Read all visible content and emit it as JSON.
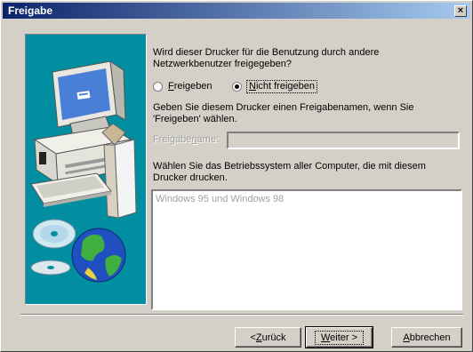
{
  "window": {
    "title": "Freigabe",
    "close_symbol": "×"
  },
  "question": {
    "line1": "Wird dieser Drucker für die Benutzung durch andere",
    "line2": "Netzwerkbenutzer freigegeben?"
  },
  "radios": {
    "share": {
      "prefix": "",
      "accel": "F",
      "rest": "reigeben",
      "selected": false
    },
    "no_share": {
      "prefix": "",
      "accel": "N",
      "rest": "icht freigeben",
      "selected": true
    }
  },
  "share_hint": {
    "line1": "Geben Sie diesem Drucker einen Freigabenamen, wenn Sie",
    "line2": "'Freigeben' wählen."
  },
  "share_name": {
    "label_before": "Freigabe",
    "label_accel": "n",
    "label_after": "ame:",
    "value": ""
  },
  "os_hint": {
    "line1": "Wählen Sie das Betriebssystem aller Computer, die mit diesem",
    "line2": "Drucker drucken."
  },
  "os_list": [
    "Windows 95 und Windows 98"
  ],
  "buttons": {
    "back": {
      "prefix": "< ",
      "accel": "Z",
      "rest": "urück"
    },
    "next": {
      "accel": "W",
      "rest": "eiter >"
    },
    "cancel": {
      "accel": "A",
      "rest": "bbrechen"
    }
  },
  "icons": [
    "close-icon",
    "computer-illustration",
    "cd-disc-icon",
    "globe-icon"
  ]
}
